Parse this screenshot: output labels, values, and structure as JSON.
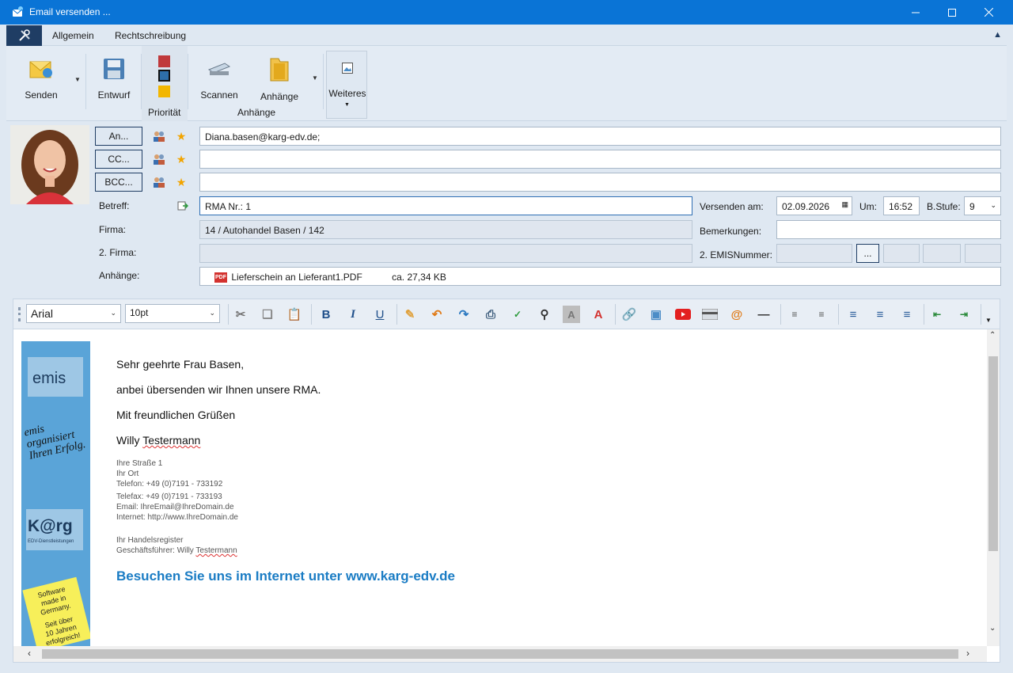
{
  "window": {
    "title": "Email versenden ..."
  },
  "tabs": {
    "general": "Allgemein",
    "spelling": "Rechtschreibung"
  },
  "ribbon": {
    "send": "Senden",
    "draft": "Entwurf",
    "priority_group": "Priorität",
    "scan": "Scannen",
    "attachments": "Anhänge",
    "attachments_group": "Anhänge",
    "more": "Weiteres"
  },
  "header": {
    "to_button": "An...",
    "cc_button": "CC...",
    "bcc_button": "BCC...",
    "to_value": "Diana.basen@karg-edv.de;",
    "cc_value": "",
    "bcc_value": "",
    "subject_label": "Betreff:",
    "subject_value": "RMA Nr.: 1",
    "company_label": "Firma:",
    "company_value": "14 / Autohandel Basen / 142",
    "company2_label": "2. Firma:",
    "company2_value": "",
    "attachments_label": "Anhänge:",
    "attachment_file": "Lieferschein an Lieferant1.PDF",
    "attachment_size": "ca. 27,34 KB",
    "send_on_label": "Versenden am:",
    "send_on_value": "02.09.2026",
    "at_label": "Um:",
    "at_value": "16:52",
    "level_label": "B.Stufe:",
    "level_value": "9",
    "remarks_label": "Bemerkungen:",
    "remarks_value": "",
    "emis_label": "2. EMISNummer:",
    "emis_button": "..."
  },
  "editor": {
    "font": "Arial",
    "size": "10pt",
    "greeting": "Sehr geehrte Frau Basen,",
    "line1": "anbei übersenden wir Ihnen unsere RMA.",
    "closing": "Mit freundlichen Grüßen",
    "signer_first": "Willy",
    "signer_last": "Testermann",
    "sig_street": "Ihre Straße 1",
    "sig_city": "Ihr Ort",
    "sig_phone": "Telefon: +49 (0)7191 - 733192",
    "sig_fax": "Telefax: +49 (0)7191 - 733193",
    "sig_email": "Email:  IhreEmail@IhreDomain.de",
    "sig_internet": "Internet: http://www.IhreDomain.de",
    "sig_register": "Ihr Handelsregister",
    "sig_ceo_prefix": "Geschäftsführer: Willy",
    "sig_ceo_last": "Testermann",
    "visit": "Besuchen Sie uns im Internet unter www.karg-edv.de",
    "banner": {
      "brand_top": "emis",
      "slogan1": "emis",
      "slogan2": "organisiert",
      "slogan3": "Ihren Erfolg.",
      "brand_bottom": "K@rg",
      "brand_sub": "EDV-Dienstleistungen",
      "note1": "Software",
      "note2": "made in",
      "note3": "Germany.",
      "note4": "Seit über",
      "note5": "10 Jahren",
      "note6": "erfolgreich!"
    }
  },
  "colors": {
    "titlebar": "#0a74d6",
    "priority_high": "#c0393b",
    "priority_normal": "#2e6fa8",
    "priority_low": "#f2b600",
    "link": "#1a7cc4"
  }
}
